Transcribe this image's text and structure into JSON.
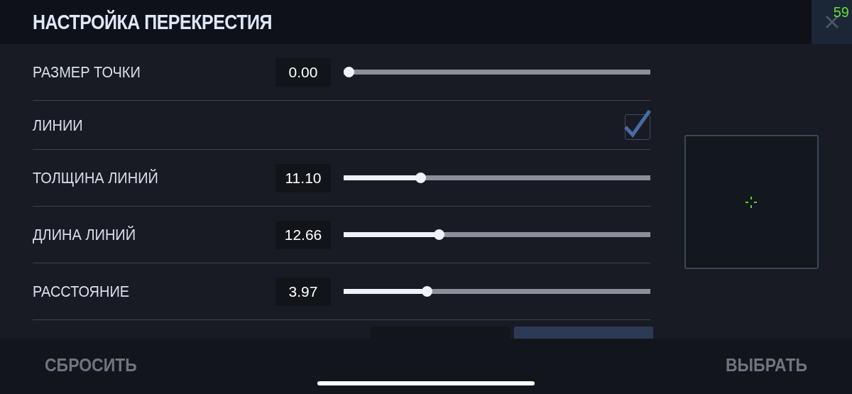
{
  "header": {
    "title": "НАСТРОЙКА ПЕРЕКРЕСТИЯ",
    "fps": "59"
  },
  "settings": [
    {
      "kind": "slider",
      "label": "РАЗМЕР ТОЧКИ",
      "value": "0.00",
      "level": 0
    },
    {
      "kind": "checkbox",
      "label": "ЛИНИИ",
      "checked": true
    },
    {
      "kind": "slider",
      "label": "ТОЛЩИНА ЛИНИЙ",
      "value": "11.10",
      "level": 0.25
    },
    {
      "kind": "slider",
      "label": "ДЛИНА ЛИНИЙ",
      "value": "12.66",
      "level": 0.31
    },
    {
      "kind": "slider",
      "label": "РАССТОЯНИЕ",
      "value": "3.97",
      "level": 0.27
    },
    {
      "kind": "segments",
      "options": [
        {
          "selected": false
        },
        {
          "selected": true
        }
      ]
    }
  ],
  "footer": {
    "reset": "СБРОСИТЬ",
    "select": "ВЫБРАТЬ"
  }
}
